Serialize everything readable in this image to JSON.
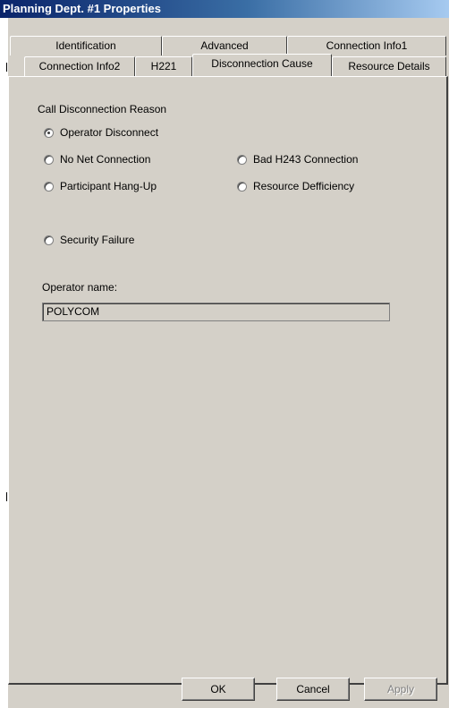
{
  "window": {
    "title": "Planning Dept. #1 Properties"
  },
  "tabs": {
    "row_back": [
      {
        "label": "Identification"
      },
      {
        "label": "Advanced"
      },
      {
        "label": "Connection Info1"
      }
    ],
    "row_front": [
      {
        "label": "Connection Info2"
      },
      {
        "label": "H221"
      },
      {
        "label": "Disconnection Cause",
        "active": true
      },
      {
        "label": "Resource Details"
      }
    ]
  },
  "group": {
    "legend": "Call Disconnection Reason",
    "options": [
      {
        "label": "Operator Disconnect",
        "checked": true
      },
      {
        "label": "No Net Connection",
        "checked": false
      },
      {
        "label": "Bad H243 Connection",
        "checked": false
      },
      {
        "label": "Participant Hang-Up",
        "checked": false
      },
      {
        "label": "Resource Defficiency",
        "checked": false
      },
      {
        "label": "Security Failure",
        "checked": false
      }
    ],
    "operator_label": "Operator name:",
    "operator_value": "POLYCOM"
  },
  "buttons": {
    "ok": "OK",
    "cancel": "Cancel",
    "apply": "Apply"
  }
}
